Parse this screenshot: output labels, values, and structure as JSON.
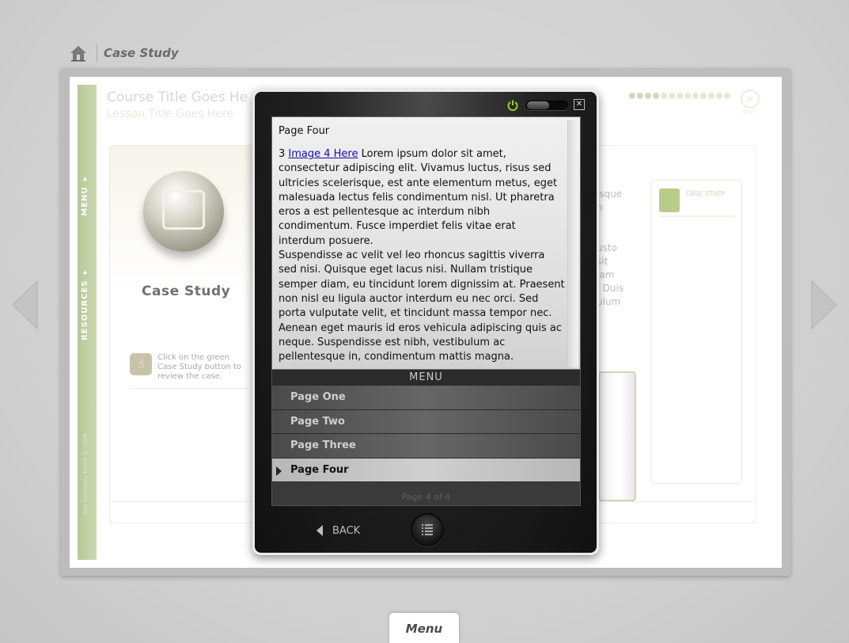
{
  "header": {
    "home_icon": "home-icon",
    "breadcrumb_title": "Case Study"
  },
  "course": {
    "course_title": "Course Title Goes He",
    "lesson_title": "Lesson Title Goes Here",
    "exit_label": "EXIT",
    "progress_total_dots": 13,
    "progress_filled_dots": 4
  },
  "sidebar": {
    "menu_label": "MENU ▾",
    "resources_label": "RESOURCES ▾",
    "copyright": "Your Company Name © 2009"
  },
  "left_card": {
    "title": "Case Study",
    "hint_text": "Click on the green Case Study button to review the case."
  },
  "mid_card": {
    "text_lines": [
      "isque",
      "n",
      "",
      "",
      "usto",
      "sit",
      "iam",
      ". Duis",
      "ulum"
    ]
  },
  "right_card": {
    "label": "CASE STUDY"
  },
  "modal": {
    "page_title": "Page Four",
    "body_prefix": "3 ",
    "image_link": "Image 4 Here",
    "body_text": " Lorem ipsum dolor sit amet, consectetur adipiscing elit. Vivamus luctus, risus sed ultricies scelerisque, est ante elementum metus, eget malesuada lectus felis condimentum nisl. Ut pharetra eros a est pellentesque ac interdum nibh condimentum. Fusce imperdiet felis vitae erat interdum posuere.",
    "body_text_2": "Suspendisse ac velit vel leo rhoncus sagittis viverra sed nisi. Quisque eget lacus nisi. Nullam tristique semper diam, eu tincidunt lorem dignissim at. Praesent non nisl eu ligula auctor interdum eu nec orci. Sed porta vulputate velit, et tincidunt massa tempor nec. Aenean eget mauris id eros vehicula adipiscing quis ac neque. Suspendisse est nibh, vestibulum ac pellentesque in, condimentum mattis magna.",
    "menu_header": "MENU",
    "menu_items": [
      "Page One",
      "Page Two",
      "Page Three",
      "Page Four"
    ],
    "active_index": 3,
    "page_count": "Page 4 of 4",
    "back_label": "BACK",
    "power_icon": "power-icon",
    "close_icon": "close-icon",
    "list_icon": "list-icon",
    "accent_color": "#9acd1a"
  },
  "footer": {
    "menu_tab": "Menu"
  }
}
